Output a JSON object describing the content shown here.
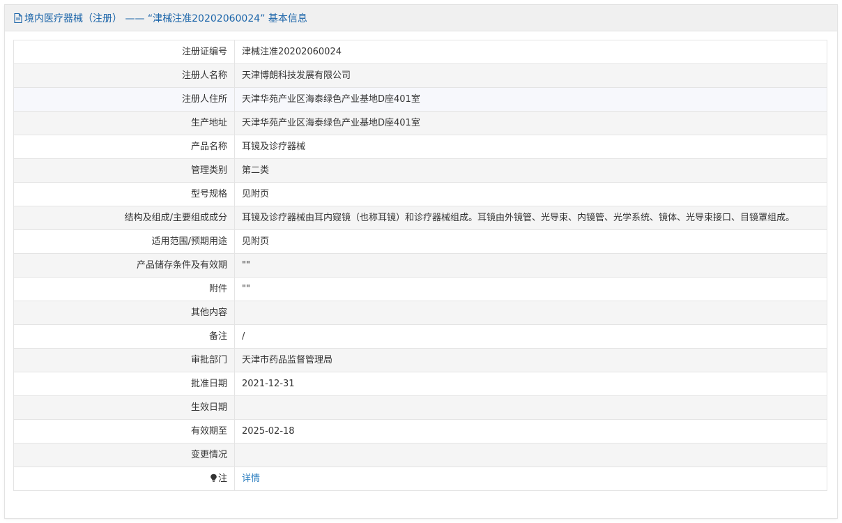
{
  "header": {
    "icon": "document-icon",
    "title": "境内医疗器械（注册） —— “津械注准20202060024” 基本信息"
  },
  "rows": [
    {
      "label": "注册证编号",
      "value": "津械注准20202060024"
    },
    {
      "label": "注册人名称",
      "value": "天津博朗科技发展有限公司"
    },
    {
      "label": "注册人住所",
      "value": "天津华苑产业区海泰绿色产业基地D座401室"
    },
    {
      "label": "生产地址",
      "value": "天津华苑产业区海泰绿色产业基地D座401室"
    },
    {
      "label": "产品名称",
      "value": "耳镜及诊疗器械"
    },
    {
      "label": "管理类别",
      "value": "第二类"
    },
    {
      "label": "型号规格",
      "value": "见附页"
    },
    {
      "label": "结构及组成/主要组成成分",
      "value": "耳镜及诊疗器械由耳内窥镜（也称耳镜）和诊疗器械组成。耳镜由外镜管、光导束、内镜管、光学系统、镜体、光导束接口、目镜罩组成。"
    },
    {
      "label": "适用范围/预期用途",
      "value": "见附页"
    },
    {
      "label": "产品储存条件及有效期",
      "value": "\"\""
    },
    {
      "label": "附件",
      "value": "\"\""
    },
    {
      "label": "其他内容",
      "value": ""
    },
    {
      "label": "备注",
      "value": "/"
    },
    {
      "label": "审批部门",
      "value": "天津市药品监督管理局"
    },
    {
      "label": "批准日期",
      "value": "2021-12-31"
    },
    {
      "label": "生效日期",
      "value": ""
    },
    {
      "label": "有效期至",
      "value": "2025-02-18"
    },
    {
      "label": "变更情况",
      "value": ""
    }
  ],
  "note_row": {
    "icon": "lightbulb-icon",
    "label": "注",
    "link_text": "详情"
  },
  "colors": {
    "title": "#1a64a9",
    "link": "#2e7fc0",
    "header_bg": "#f0f0f0",
    "border": "#e4e4e4"
  }
}
